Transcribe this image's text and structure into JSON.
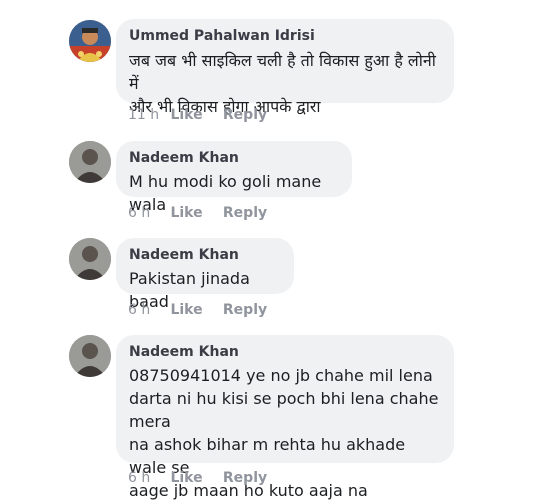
{
  "comments": [
    {
      "author": "Ummed Pahalwan Idrisi",
      "text": "जब जब भी साइकिल चली है तो विकास हुआ है लोनी में\nऔर भी विकास होगा आपके द्वारा",
      "time": "11 h",
      "like_label": "Like",
      "reply_label": "Reply"
    },
    {
      "author": "Nadeem Khan",
      "text": "M hu modi ko goli mane wala",
      "time": "6 h",
      "like_label": "Like",
      "reply_label": "Reply"
    },
    {
      "author": "Nadeem Khan",
      "text": "Pakistan jinada baad",
      "time": "6 h",
      "like_label": "Like",
      "reply_label": "Reply"
    },
    {
      "author": "Nadeem Khan",
      "text": "08750941014  ye no jb chahe mil lena\ndarta ni hu kisi se poch bhi lena chahe mera\nna ashok bihar m rehta hu akhade wale se\naage jb maan ho kuto aaja na",
      "time": "6 h",
      "like_label": "Like",
      "reply_label": "Reply"
    }
  ],
  "colors": {
    "bubble_bg": "#f0f1f3",
    "name": "#3a3d45",
    "text": "#1c1e21",
    "meta": "#90949c"
  }
}
